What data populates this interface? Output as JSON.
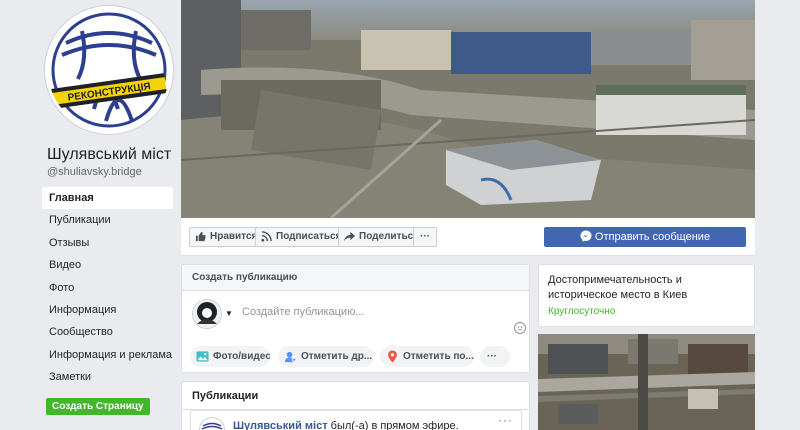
{
  "page": {
    "name": "Шулявський міст",
    "handle": "@shuliavsky.bridge",
    "logo_text": "РЕКОНСТРУКЦІЯ"
  },
  "nav": {
    "items": [
      {
        "label": "Главная",
        "active": true
      },
      {
        "label": "Публикации"
      },
      {
        "label": "Отзывы"
      },
      {
        "label": "Видео"
      },
      {
        "label": "Фото"
      },
      {
        "label": "Информация"
      },
      {
        "label": "Сообщество"
      },
      {
        "label": "Информация и реклама"
      },
      {
        "label": "Заметки"
      }
    ],
    "create_page": "Создать Страницу"
  },
  "actions": {
    "like": "Нравится",
    "follow": "Подписаться",
    "share": "Поделиться",
    "more": "···",
    "message": "Отправить сообщение"
  },
  "composer": {
    "title": "Создать публикацию",
    "placeholder": "Создайте публикацию...",
    "photo_video": "Фото/видео",
    "tag_friends": "Отметить др...",
    "check_in": "Отметить по...",
    "more": "···"
  },
  "publications": {
    "title": "Публикации",
    "entry_author": "Шулявський міст",
    "entry_text": " был(-а) в прямом эфире.",
    "dots": "···"
  },
  "about": {
    "category": "Достопримечательность и историческое место в Киев",
    "hours": "Круглосуточно"
  },
  "colors": {
    "brand_blue": "#4267b2",
    "link": "#365899",
    "green": "#42b72a",
    "background": "#e9ebee",
    "logo_blue": "#2e3f8f",
    "logo_yellow": "#f5d20a"
  }
}
